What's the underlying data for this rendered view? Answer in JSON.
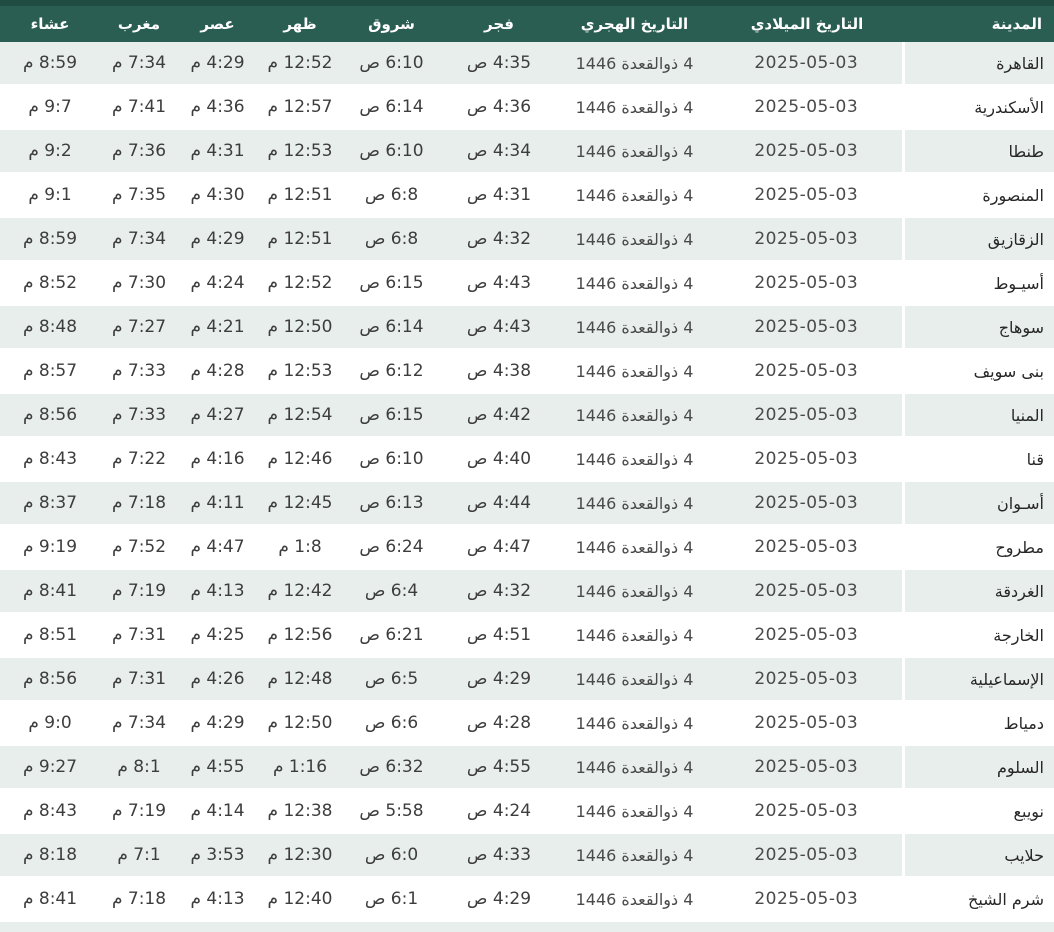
{
  "table": {
    "headers": {
      "city": "المدينة",
      "gregorian": "التاريخ الميلادي",
      "hijri": "التاريخ الهجري",
      "fajr": "فجر",
      "sunrise": "شروق",
      "dhuhr": "ظهر",
      "asr": "عصر",
      "maghrib": "مغرب",
      "isha": "عشاء"
    },
    "rows": [
      [
        "القاهرة",
        "2025-05-03",
        "4 ذوالقعدة 1446",
        "4:35 ص",
        "6:10 ص",
        "12:52 م",
        "4:29 م",
        "7:34 م",
        "8:59 م"
      ],
      [
        "الأسكندرية",
        "2025-05-03",
        "4 ذوالقعدة 1446",
        "4:36 ص",
        "6:14 ص",
        "12:57 م",
        "4:36 م",
        "7:41 م",
        "9:7 م"
      ],
      [
        "طنطا",
        "2025-05-03",
        "4 ذوالقعدة 1446",
        "4:34 ص",
        "6:10 ص",
        "12:53 م",
        "4:31 م",
        "7:36 م",
        "9:2 م"
      ],
      [
        "المنصورة",
        "2025-05-03",
        "4 ذوالقعدة 1446",
        "4:31 ص",
        "6:8 ص",
        "12:51 م",
        "4:30 م",
        "7:35 م",
        "9:1 م"
      ],
      [
        "الزقازيق",
        "2025-05-03",
        "4 ذوالقعدة 1446",
        "4:32 ص",
        "6:8 ص",
        "12:51 م",
        "4:29 م",
        "7:34 م",
        "8:59 م"
      ],
      [
        "أسيـوط",
        "2025-05-03",
        "4 ذوالقعدة 1446",
        "4:43 ص",
        "6:15 ص",
        "12:52 م",
        "4:24 م",
        "7:30 م",
        "8:52 م"
      ],
      [
        "سوهاج",
        "2025-05-03",
        "4 ذوالقعدة 1446",
        "4:43 ص",
        "6:14 ص",
        "12:50 م",
        "4:21 م",
        "7:27 م",
        "8:48 م"
      ],
      [
        "بنى سويف",
        "2025-05-03",
        "4 ذوالقعدة 1446",
        "4:38 ص",
        "6:12 ص",
        "12:53 م",
        "4:28 م",
        "7:33 م",
        "8:57 م"
      ],
      [
        "المنيا",
        "2025-05-03",
        "4 ذوالقعدة 1446",
        "4:42 ص",
        "6:15 ص",
        "12:54 م",
        "4:27 م",
        "7:33 م",
        "8:56 م"
      ],
      [
        "قنا",
        "2025-05-03",
        "4 ذوالقعدة 1446",
        "4:40 ص",
        "6:10 ص",
        "12:46 م",
        "4:16 م",
        "7:22 م",
        "8:43 م"
      ],
      [
        "أسـوان",
        "2025-05-03",
        "4 ذوالقعدة 1446",
        "4:44 ص",
        "6:13 ص",
        "12:45 م",
        "4:11 م",
        "7:18 م",
        "8:37 م"
      ],
      [
        "مطروح",
        "2025-05-03",
        "4 ذوالقعدة 1446",
        "4:47 ص",
        "6:24 ص",
        "1:8 م",
        "4:47 م",
        "7:52 م",
        "9:19 م"
      ],
      [
        "الغردقة",
        "2025-05-03",
        "4 ذوالقعدة 1446",
        "4:32 ص",
        "6:4 ص",
        "12:42 م",
        "4:13 م",
        "7:19 م",
        "8:41 م"
      ],
      [
        "الخارجة",
        "2025-05-03",
        "4 ذوالقعدة 1446",
        "4:51 ص",
        "6:21 ص",
        "12:56 م",
        "4:25 م",
        "7:31 م",
        "8:51 م"
      ],
      [
        "الإسماعيلية",
        "2025-05-03",
        "4 ذوالقعدة 1446",
        "4:29 ص",
        "6:5 ص",
        "12:48 م",
        "4:26 م",
        "7:31 م",
        "8:56 م"
      ],
      [
        "دمياط",
        "2025-05-03",
        "4 ذوالقعدة 1446",
        "4:28 ص",
        "6:6 ص",
        "12:50 م",
        "4:29 م",
        "7:34 م",
        "9:0 م"
      ],
      [
        "السلوم",
        "2025-05-03",
        "4 ذوالقعدة 1446",
        "4:55 ص",
        "6:32 ص",
        "1:16 م",
        "4:55 م",
        "8:1 م",
        "9:27 م"
      ],
      [
        "نويبع",
        "2025-05-03",
        "4 ذوالقعدة 1446",
        "4:24 ص",
        "5:58 ص",
        "12:38 م",
        "4:14 م",
        "7:19 م",
        "8:43 م"
      ],
      [
        "حلايب",
        "2025-05-03",
        "4 ذوالقعدة 1446",
        "4:33 ص",
        "6:0 ص",
        "12:30 م",
        "3:53 م",
        "7:1 م",
        "8:18 م"
      ],
      [
        "شرم الشيخ",
        "2025-05-03",
        "4 ذوالقعدة 1446",
        "4:29 ص",
        "6:1 ص",
        "12:40 م",
        "4:13 م",
        "7:18 م",
        "8:41 م"
      ]
    ]
  },
  "colors": {
    "header_bg": "#2b5e52",
    "header_top_strip": "#1f4d42",
    "header_text": "#ffffff",
    "row_alt_bg": "#e8eeec",
    "time_text": "#3d3d3d",
    "date_text": "#4a4a4a",
    "city_text": "#272727"
  }
}
